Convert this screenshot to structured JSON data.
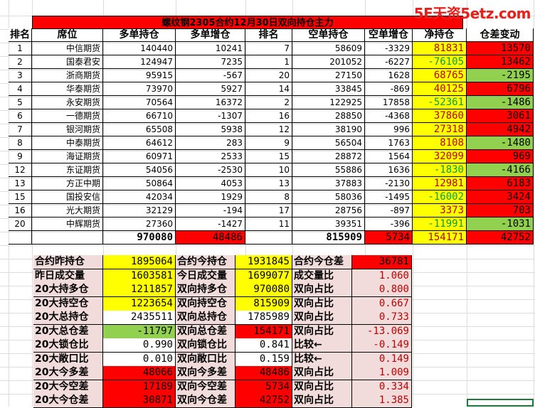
{
  "watermark": "5E天资5etz.com",
  "title": "螺纹钢2305合约12月30日双向持仓主力",
  "colors": {
    "red": "#ff0000",
    "yellow": "#ffff00",
    "green": "#92d050",
    "pink": "#f2dcdb",
    "dark_red_text": "#c00000",
    "green_text": "#00a04a"
  },
  "headers": [
    "排名",
    "席位",
    "多单持仓",
    "多单增仓",
    "排名",
    "空单持仓",
    "空单增仓",
    "净持仓",
    "仓差变动"
  ],
  "rows": [
    {
      "rank": "1",
      "seat": "中信期货",
      "long": "140440",
      "long_chg": "10241",
      "srank": "7",
      "short": "58609",
      "short_chg": "-3329",
      "net": "81831",
      "diff": "13570"
    },
    {
      "rank": "2",
      "seat": "国泰君安",
      "long": "124947",
      "long_chg": "7235",
      "srank": "1",
      "short": "201052",
      "short_chg": "-6227",
      "net": "-76105",
      "diff": "13462"
    },
    {
      "rank": "3",
      "seat": "浙商期货",
      "long": "95915",
      "long_chg": "-567",
      "srank": "20",
      "short": "27150",
      "short_chg": "1628",
      "net": "68765",
      "diff": "-2195"
    },
    {
      "rank": "4",
      "seat": "华泰期货",
      "long": "73970",
      "long_chg": "5927",
      "srank": "14",
      "short": "33845",
      "short_chg": "-869",
      "net": "40125",
      "diff": "6796"
    },
    {
      "rank": "5",
      "seat": "永安期货",
      "long": "70564",
      "long_chg": "16372",
      "srank": "2",
      "short": "122925",
      "short_chg": "17858",
      "net": "-52361",
      "diff": "-1486"
    },
    {
      "rank": "6",
      "seat": "一德期货",
      "long": "66710",
      "long_chg": "-1307",
      "srank": "16",
      "short": "28850",
      "short_chg": "-4368",
      "net": "37860",
      "diff": "3061"
    },
    {
      "rank": "7",
      "seat": "银河期货",
      "long": "65508",
      "long_chg": "5938",
      "srank": "12",
      "short": "38190",
      "short_chg": "996",
      "net": "27318",
      "diff": "4942"
    },
    {
      "rank": "8",
      "seat": "中泰期货",
      "long": "64612",
      "long_chg": "283",
      "srank": "9",
      "short": "56504",
      "short_chg": "1763",
      "net": "8108",
      "diff": "-1480"
    },
    {
      "rank": "9",
      "seat": "海证期货",
      "long": "60971",
      "long_chg": "2533",
      "srank": "15",
      "short": "28872",
      "short_chg": "1564",
      "net": "32099",
      "diff": "969"
    },
    {
      "rank": "12",
      "seat": "东证期货",
      "long": "54056",
      "long_chg": "-2530",
      "srank": "10",
      "short": "55886",
      "short_chg": "1636",
      "net": "-1830",
      "diff": "-4166"
    },
    {
      "rank": "13",
      "seat": "方正中期",
      "long": "50864",
      "long_chg": "4053",
      "srank": "13",
      "short": "37883",
      "short_chg": "-2130",
      "net": "12981",
      "diff": "6183"
    },
    {
      "rank": "15",
      "seat": "国投安信",
      "long": "42034",
      "long_chg": "1929",
      "srank": "8",
      "short": "58036",
      "short_chg": "-1495",
      "net": "-16002",
      "diff": "3424"
    },
    {
      "rank": "16",
      "seat": "光大期货",
      "long": "32129",
      "long_chg": "-194",
      "srank": "17",
      "short": "28756",
      "short_chg": "-897",
      "net": "3373",
      "diff": "703"
    },
    {
      "rank": "20",
      "seat": "中辉期货",
      "long": "27360",
      "long_chg": "-1427",
      "srank": "11",
      "short": "39351",
      "short_chg": "-396",
      "net": "-11991",
      "diff": "-1031"
    }
  ],
  "totals": {
    "long": "970080",
    "long_chg": "48486",
    "short": "815909",
    "short_chg": "5734",
    "net": "154171",
    "diff": "42752"
  },
  "summary": [
    {
      "l1": "合约昨持仓",
      "v1": "1895064",
      "l2": "合约今持仓",
      "v2": "1931845",
      "l3": "合约今仓差",
      "v3": "36781"
    },
    {
      "l1": "昨日成交量",
      "v1": "1603581",
      "l2": "今日成交量",
      "v2": "1699077",
      "l3": "成交量比",
      "v3": "1.060"
    },
    {
      "l1": "20大持多仓",
      "v1": "1211857",
      "l2": "双向持多仓",
      "v2": "970080",
      "l3": "双向占比",
      "v3": "0.800"
    },
    {
      "l1": "20大持空仓",
      "v1": "1223654",
      "l2": "双向持空仓",
      "v2": "815909",
      "l3": "双向占比",
      "v3": "0.667"
    },
    {
      "l1": "20大总持仓",
      "v1": "2435511",
      "l2": "双向总持仓",
      "v2": "1785989",
      "l3": "双向占比",
      "v3": "0.733"
    },
    {
      "l1": "20大总仓差",
      "v1": "-11797",
      "l2": "双向总仓差",
      "v2": "154171",
      "l3": "双向占比",
      "v3": "-13.069"
    },
    {
      "l1": "20大锁仓比",
      "v1": "0.990",
      "l2": "双向锁仓比",
      "v2": "0.841",
      "l3": "比较←",
      "v3": "-0.149"
    },
    {
      "l1": "20大敞口比",
      "v1": "0.010",
      "l2": "双向敞口比",
      "v2": "0.159",
      "l3": "比较←",
      "v3": "0.149"
    },
    {
      "l1": "20大今多差",
      "v1": "48066",
      "l2": "双向今多差",
      "v2": "48486",
      "l3": "双向占比",
      "v3": "1.009"
    },
    {
      "l1": "20大今空差",
      "v1": "17189",
      "l2": "双向今空差",
      "v2": "5734",
      "l3": "双向占比",
      "v3": "0.334"
    },
    {
      "l1": "20大今仓差",
      "v1": "30871",
      "l2": "双向今仓差",
      "v2": "42752",
      "l3": "双向占比",
      "v3": "1.385"
    }
  ]
}
